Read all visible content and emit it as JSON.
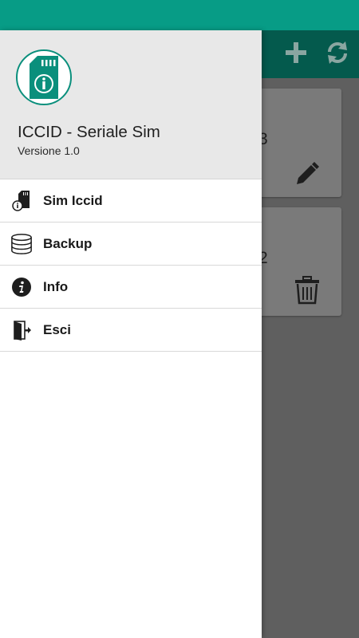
{
  "app_bar": {
    "actions": [
      {
        "icon": "add-icon"
      },
      {
        "icon": "refresh-icon"
      }
    ]
  },
  "cards": [
    {
      "number_partial": "3",
      "icon": "edit-icon"
    },
    {
      "number_partial": "2",
      "icon": "trash-icon"
    }
  ],
  "drawer": {
    "header": {
      "logo_icon": "sim-card-info-icon",
      "title": "ICCID - Seriale Sim",
      "version": "Versione 1.0"
    },
    "menu": [
      {
        "label": "Sim Iccid",
        "icon": "sim-card-icon"
      },
      {
        "label": "Backup",
        "icon": "database-icon"
      },
      {
        "label": "Info",
        "icon": "info-icon"
      },
      {
        "label": "Esci",
        "icon": "exit-icon"
      }
    ]
  },
  "colors": {
    "status_bar": "#079c86",
    "app_bar": "#045a4d",
    "accent": "#0a8f7c",
    "scrim": "#5f5f5f"
  }
}
